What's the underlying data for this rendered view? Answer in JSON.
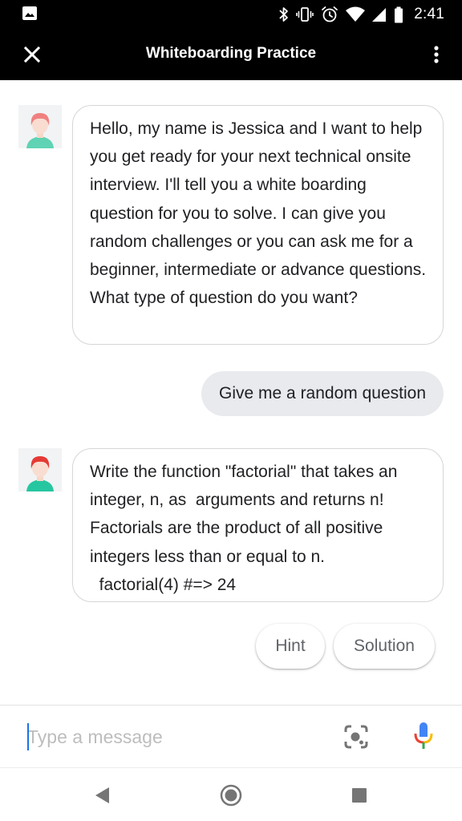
{
  "status_bar": {
    "time": "2:41",
    "icons": [
      "image-icon",
      "bluetooth-icon",
      "vibrate-icon",
      "alarm-icon",
      "wifi-icon",
      "cell-signal-icon",
      "battery-icon"
    ]
  },
  "app_bar": {
    "title": "Whiteboarding Practice",
    "close_icon": "close-icon",
    "menu_icon": "more-vert-icon"
  },
  "conversation": {
    "messages": [
      {
        "sender": "bot",
        "text": "Hello, my name is Jessica and I want to help you get ready for your next technical onsite interview. I'll tell you a white boarding question for you to solve. I can give you random challenges or you can ask me for a beginner, intermediate or advance questions. What type of question do you want?"
      },
      {
        "sender": "user",
        "text": "Give me a random question"
      },
      {
        "sender": "bot",
        "text": "Write the function \"factorial\" that takes an integer, n, as  arguments and returns n! Factorials are the product of all positive integers less than or equal to n.\n  factorial(4) #=> 24"
      }
    ],
    "suggestions": [
      "Hint",
      "Solution"
    ]
  },
  "composer": {
    "placeholder": "Type a message",
    "value": "",
    "lens_icon": "lens-icon",
    "mic_icon": "mic-icon"
  },
  "nav_bar": {
    "icons": [
      "back-icon",
      "home-icon",
      "recents-icon"
    ]
  },
  "colors": {
    "bar_background": "#000000",
    "user_bubble": "#e8eaed",
    "bot_bubble_border": "#d6d6d6",
    "avatar_hair": "#e53935",
    "avatar_shirt": "#26c6a0",
    "caret": "#1a73e8"
  }
}
